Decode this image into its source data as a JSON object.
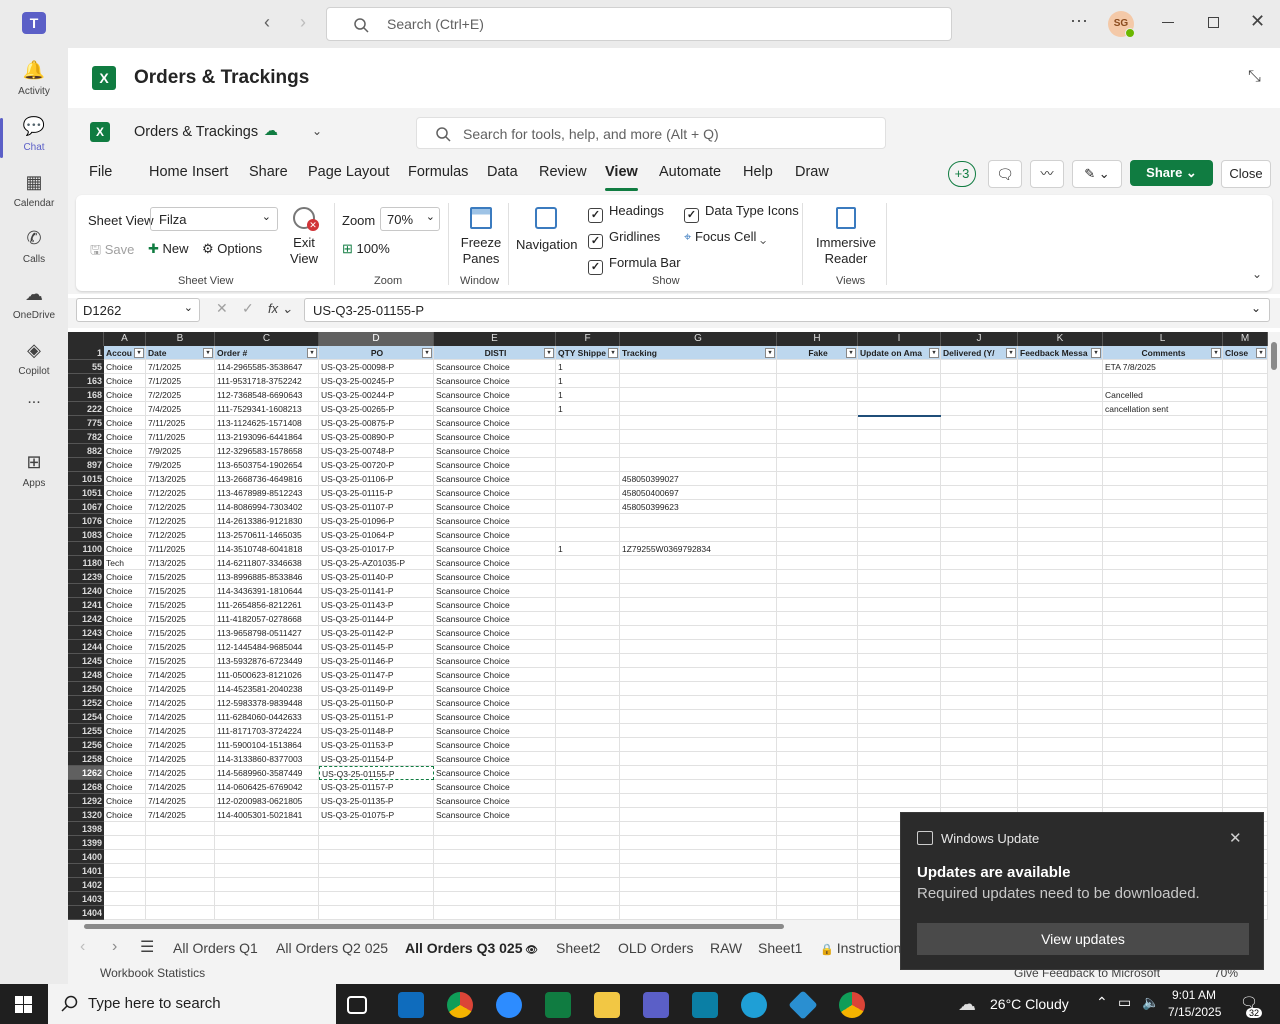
{
  "teams": {
    "search_placeholder": "Search (Ctrl+E)",
    "avatar_initials": "SG",
    "rail": [
      {
        "label": "Activity",
        "icon": "bell-icon"
      },
      {
        "label": "Chat",
        "icon": "chat-icon"
      },
      {
        "label": "Calendar",
        "icon": "calendar-icon"
      },
      {
        "label": "Calls",
        "icon": "phone-icon"
      },
      {
        "label": "OneDrive",
        "icon": "cloud-icon"
      },
      {
        "label": "Copilot",
        "icon": "copilot-icon"
      },
      {
        "label": "...",
        "icon": "more-icon"
      },
      {
        "label": "Apps",
        "icon": "apps-icon"
      }
    ]
  },
  "header": {
    "title": "Orders & Trackings"
  },
  "excel": {
    "doc_title": "Orders & Trackings",
    "search_placeholder": "Search for tools, help, and more (Alt + Q)",
    "tabs": [
      "File",
      "Home",
      "Insert",
      "Share",
      "Page Layout",
      "Formulas",
      "Data",
      "Review",
      "View",
      "Automate",
      "Help",
      "Draw"
    ],
    "active_tab": "View",
    "more_count": "+3",
    "share_label": "Share",
    "close_label": "Close"
  },
  "ribbon": {
    "sheet_view_label": "Sheet View",
    "sheet_view_value": "Filza",
    "save": "Save",
    "new": "New",
    "options": "Options",
    "exit_view": "Exit View",
    "group_sheet_view": "Sheet View",
    "zoom_label": "Zoom",
    "zoom_value": "70%",
    "zoom_100": "100%",
    "group_zoom": "Zoom",
    "freeze_panes": "Freeze Panes",
    "group_window": "Window",
    "navigation": "Navigation",
    "headings": "Headings",
    "gridlines": "Gridlines",
    "formula_bar": "Formula Bar",
    "data_type_icons": "Data Type Icons",
    "focus_cell": "Focus Cell",
    "group_show": "Show",
    "immersive_reader": "Immersive Reader",
    "group_views": "Views"
  },
  "formula_bar": {
    "name_box": "D1262",
    "fx": "fx",
    "value": "US-Q3-25-01155-P"
  },
  "columns": [
    {
      "letter": "A",
      "header": "Accou"
    },
    {
      "letter": "B",
      "header": "Date"
    },
    {
      "letter": "C",
      "header": "Order #"
    },
    {
      "letter": "D",
      "header": "PO"
    },
    {
      "letter": "E",
      "header": "DISTI"
    },
    {
      "letter": "F",
      "header": "QTY Shippe"
    },
    {
      "letter": "G",
      "header": "Tracking"
    },
    {
      "letter": "H",
      "header": "Fake"
    },
    {
      "letter": "I",
      "header": "Update on Ama"
    },
    {
      "letter": "J",
      "header": "Delivered (Y/"
    },
    {
      "letter": "K",
      "header": "Feedback Messa"
    },
    {
      "letter": "L",
      "header": "Comments"
    },
    {
      "letter": "M",
      "header": "Close"
    }
  ],
  "rows": [
    {
      "n": "55",
      "a": "Choice",
      "b": "7/1/2025",
      "c": "114-2965585-3538647",
      "d": "US-Q3-25-00098-P",
      "e": "Scansource Choice",
      "f": "1",
      "g": "",
      "l": "ETA 7/8/2025"
    },
    {
      "n": "163",
      "a": "Choice",
      "b": "7/1/2025",
      "c": "111-9531718-3752242",
      "d": "US-Q3-25-00245-P",
      "e": "Scansource Choice",
      "f": "1",
      "g": "",
      "l": ""
    },
    {
      "n": "168",
      "a": "Choice",
      "b": "7/2/2025",
      "c": "112-7368548-6690643",
      "d": "US-Q3-25-00244-P",
      "e": "Scansource Choice",
      "f": "1",
      "g": "",
      "l": "Cancelled"
    },
    {
      "n": "222",
      "a": "Choice",
      "b": "7/4/2025",
      "c": "111-7529341-1608213",
      "d": "US-Q3-25-00265-P",
      "e": "Scansource Choice",
      "f": "1",
      "g": "",
      "l": "cancellation sent"
    },
    {
      "n": "775",
      "a": "Choice",
      "b": "7/11/2025",
      "c": "113-1124625-1571408",
      "d": "US-Q3-25-00875-P",
      "e": "Scansource Choice",
      "f": "",
      "g": "",
      "l": ""
    },
    {
      "n": "782",
      "a": "Choice",
      "b": "7/11/2025",
      "c": "113-2193096-6441864",
      "d": "US-Q3-25-00890-P",
      "e": "Scansource Choice",
      "f": "",
      "g": "",
      "l": ""
    },
    {
      "n": "882",
      "a": "Choice",
      "b": "7/9/2025",
      "c": "112-3296583-1578658",
      "d": "US-Q3-25-00748-P",
      "e": "Scansource Choice",
      "f": "",
      "g": "",
      "l": ""
    },
    {
      "n": "897",
      "a": "Choice",
      "b": "7/9/2025",
      "c": "113-6503754-1902654",
      "d": "US-Q3-25-00720-P",
      "e": "Scansource Choice",
      "f": "",
      "g": "",
      "l": ""
    },
    {
      "n": "1015",
      "a": "Choice",
      "b": "7/13/2025",
      "c": "113-2668736-4649816",
      "d": "US-Q3-25-01106-P",
      "e": "Scansource Choice",
      "f": "",
      "g": "458050399027",
      "l": ""
    },
    {
      "n": "1051",
      "a": "Choice",
      "b": "7/12/2025",
      "c": "113-4678989-8512243",
      "d": "US-Q3-25-01115-P",
      "e": "Scansource Choice",
      "f": "",
      "g": "458050400697",
      "l": ""
    },
    {
      "n": "1067",
      "a": "Choice",
      "b": "7/12/2025",
      "c": "114-8086994-7303402",
      "d": "US-Q3-25-01107-P",
      "e": "Scansource Choice",
      "f": "",
      "g": "458050399623",
      "l": ""
    },
    {
      "n": "1076",
      "a": "Choice",
      "b": "7/12/2025",
      "c": "114-2613386-9121830",
      "d": "US-Q3-25-01096-P",
      "e": "Scansource Choice",
      "f": "",
      "g": "",
      "l": ""
    },
    {
      "n": "1083",
      "a": "Choice",
      "b": "7/12/2025",
      "c": "113-2570611-1465035",
      "d": "US-Q3-25-01064-P",
      "e": "Scansource Choice",
      "f": "",
      "g": "",
      "l": ""
    },
    {
      "n": "1100",
      "a": "Choice",
      "b": "7/11/2025",
      "c": "114-3510748-6041818",
      "d": "US-Q3-25-01017-P",
      "e": "Scansource Choice",
      "f": "1",
      "g": "1Z79255W0369792834",
      "l": ""
    },
    {
      "n": "1180",
      "a": "Tech",
      "b": "7/13/2025",
      "c": "114-6211807-3346638",
      "d": "US-Q3-25-AZ01035-P",
      "e": "Scansource Choice",
      "f": "",
      "g": "",
      "l": ""
    },
    {
      "n": "1239",
      "a": "Choice",
      "b": "7/15/2025",
      "c": "113-8996885-8533846",
      "d": "US-Q3-25-01140-P",
      "e": "Scansource Choice",
      "f": "",
      "g": "",
      "l": ""
    },
    {
      "n": "1240",
      "a": "Choice",
      "b": "7/15/2025",
      "c": "114-3436391-1810644",
      "d": "US-Q3-25-01141-P",
      "e": "Scansource Choice",
      "f": "",
      "g": "",
      "l": ""
    },
    {
      "n": "1241",
      "a": "Choice",
      "b": "7/15/2025",
      "c": "111-2654856-8212261",
      "d": "US-Q3-25-01143-P",
      "e": "Scansource Choice",
      "f": "",
      "g": "",
      "l": ""
    },
    {
      "n": "1242",
      "a": "Choice",
      "b": "7/15/2025",
      "c": "111-4182057-0278668",
      "d": "US-Q3-25-01144-P",
      "e": "Scansource Choice",
      "f": "",
      "g": "",
      "l": ""
    },
    {
      "n": "1243",
      "a": "Choice",
      "b": "7/15/2025",
      "c": "113-9658798-0511427",
      "d": "US-Q3-25-01142-P",
      "e": "Scansource Choice",
      "f": "",
      "g": "",
      "l": ""
    },
    {
      "n": "1244",
      "a": "Choice",
      "b": "7/15/2025",
      "c": "112-1445484-9685044",
      "d": "US-Q3-25-01145-P",
      "e": "Scansource Choice",
      "f": "",
      "g": "",
      "l": ""
    },
    {
      "n": "1245",
      "a": "Choice",
      "b": "7/15/2025",
      "c": "113-5932876-6723449",
      "d": "US-Q3-25-01146-P",
      "e": "Scansource Choice",
      "f": "",
      "g": "",
      "l": ""
    },
    {
      "n": "1248",
      "a": "Choice",
      "b": "7/14/2025",
      "c": "111-0500623-8121026",
      "d": "US-Q3-25-01147-P",
      "e": "Scansource Choice",
      "f": "",
      "g": "",
      "l": ""
    },
    {
      "n": "1250",
      "a": "Choice",
      "b": "7/14/2025",
      "c": "114-4523581-2040238",
      "d": "US-Q3-25-01149-P",
      "e": "Scansource Choice",
      "f": "",
      "g": "",
      "l": ""
    },
    {
      "n": "1252",
      "a": "Choice",
      "b": "7/14/2025",
      "c": "112-5983378-9839448",
      "d": "US-Q3-25-01150-P",
      "e": "Scansource Choice",
      "f": "",
      "g": "",
      "l": ""
    },
    {
      "n": "1254",
      "a": "Choice",
      "b": "7/14/2025",
      "c": "111-6284060-0442633",
      "d": "US-Q3-25-01151-P",
      "e": "Scansource Choice",
      "f": "",
      "g": "",
      "l": ""
    },
    {
      "n": "1255",
      "a": "Choice",
      "b": "7/14/2025",
      "c": "111-8171703-3724224",
      "d": "US-Q3-25-01148-P",
      "e": "Scansource Choice",
      "f": "",
      "g": "",
      "l": ""
    },
    {
      "n": "1256",
      "a": "Choice",
      "b": "7/14/2025",
      "c": "111-5900104-1513864",
      "d": "US-Q3-25-01153-P",
      "e": "Scansource Choice",
      "f": "",
      "g": "",
      "l": ""
    },
    {
      "n": "1258",
      "a": "Choice",
      "b": "7/14/2025",
      "c": "114-3133860-8377003",
      "d": "US-Q3-25-01154-P",
      "e": "Scansource Choice",
      "f": "",
      "g": "",
      "l": ""
    },
    {
      "n": "1262",
      "a": "Choice",
      "b": "7/14/2025",
      "c": "114-5689960-3587449",
      "d": "US-Q3-25-01155-P",
      "e": "Scansource Choice",
      "f": "",
      "g": "",
      "l": ""
    },
    {
      "n": "1268",
      "a": "Choice",
      "b": "7/14/2025",
      "c": "114-0606425-6769042",
      "d": "US-Q3-25-01157-P",
      "e": "Scansource Choice",
      "f": "",
      "g": "",
      "l": ""
    },
    {
      "n": "1292",
      "a": "Choice",
      "b": "7/14/2025",
      "c": "112-0200983-0621805",
      "d": "US-Q3-25-01135-P",
      "e": "Scansource Choice",
      "f": "",
      "g": "",
      "l": ""
    },
    {
      "n": "1320",
      "a": "Choice",
      "b": "7/14/2025",
      "c": "114-4005301-5021841",
      "d": "US-Q3-25-01075-P",
      "e": "Scansource Choice",
      "f": "",
      "g": "",
      "l": ""
    },
    {
      "n": "1398",
      "a": "",
      "b": "",
      "c": "",
      "d": "",
      "e": "",
      "f": "",
      "g": "",
      "l": ""
    },
    {
      "n": "1399",
      "a": "",
      "b": "",
      "c": "",
      "d": "",
      "e": "",
      "f": "",
      "g": "",
      "l": ""
    },
    {
      "n": "1400",
      "a": "",
      "b": "",
      "c": "",
      "d": "",
      "e": "",
      "f": "",
      "g": "",
      "l": ""
    },
    {
      "n": "1401",
      "a": "",
      "b": "",
      "c": "",
      "d": "",
      "e": "",
      "f": "",
      "g": "",
      "l": ""
    },
    {
      "n": "1402",
      "a": "",
      "b": "",
      "c": "",
      "d": "",
      "e": "",
      "f": "",
      "g": "",
      "l": ""
    },
    {
      "n": "1403",
      "a": "",
      "b": "",
      "c": "",
      "d": "",
      "e": "",
      "f": "",
      "g": "",
      "l": ""
    },
    {
      "n": "1404",
      "a": "",
      "b": "",
      "c": "",
      "d": "",
      "e": "",
      "f": "",
      "g": "",
      "l": ""
    }
  ],
  "selected_row": "1262",
  "sheet_tabs": [
    "All Orders Q1",
    "All Orders Q2 025",
    "All Orders Q3 025",
    "Sheet2",
    "OLD Orders",
    "RAW",
    "Sheet1",
    "Instruction"
  ],
  "active_sheet": "All Orders Q3 025",
  "status": {
    "workbook_stats": "Workbook Statistics",
    "feedback": "Give Feedback to Microsoft",
    "zoom": "70%"
  },
  "toast": {
    "app": "Windows Update",
    "title": "Updates are available",
    "body": "Required updates need to be downloaded.",
    "button": "View updates"
  },
  "taskbar": {
    "search_placeholder": "Type here to search",
    "weather": "26°C  Cloudy",
    "time": "9:01 AM",
    "date": "7/15/2025",
    "notifications": "32"
  },
  "colors": {
    "excel_green": "#107c41",
    "teams_purple": "#5b5fc7",
    "header_fill": "#bdd7ee"
  }
}
